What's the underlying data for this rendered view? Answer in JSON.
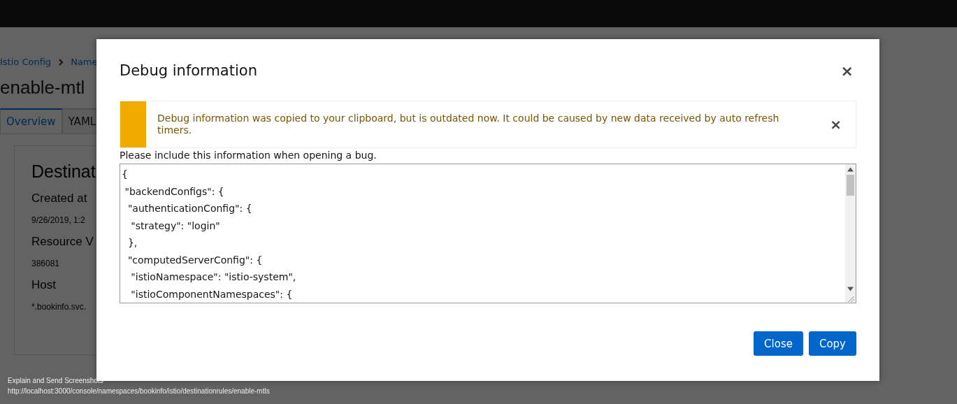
{
  "page": {
    "breadcrumbs": [
      "Istio Config",
      "Name"
    ],
    "title": "enable-mtl",
    "tabs": [
      {
        "label": "Overview",
        "selected": true
      },
      {
        "label": "YAML",
        "selected": false
      }
    ],
    "card": {
      "heading": "Destinat",
      "fields": [
        {
          "label": "Created at",
          "value": "9/26/2019, 1:2"
        },
        {
          "label": "Resource V",
          "value": "386081"
        },
        {
          "label": "Host",
          "value": "*.bookinfo.svc."
        }
      ]
    }
  },
  "modal": {
    "title": "Debug information",
    "close": "×",
    "alert": {
      "kind": "warning",
      "message": "Debug information was copied to your clipboard, but is outdated now. It could be caused by new data received by auto refresh timers.",
      "close": "×"
    },
    "label": "Please include this information when opening a bug.",
    "code_lines": [
      "{",
      " \"backendConfigs\": {",
      "  \"authenticationConfig\": {",
      "   \"strategy\": \"login\"",
      "  },",
      "  \"computedServerConfig\": {",
      "   \"istioNamespace\": \"istio-system\",",
      "   \"istioComponentNamespaces\": {"
    ],
    "buttons": [
      "Close",
      "Copy"
    ]
  },
  "status_tooltip": [
    "Explain and Send Screenshots",
    "http://localhost:3000/console/namespaces/bookinfo/istio/destinationrules/enable-mtls"
  ]
}
